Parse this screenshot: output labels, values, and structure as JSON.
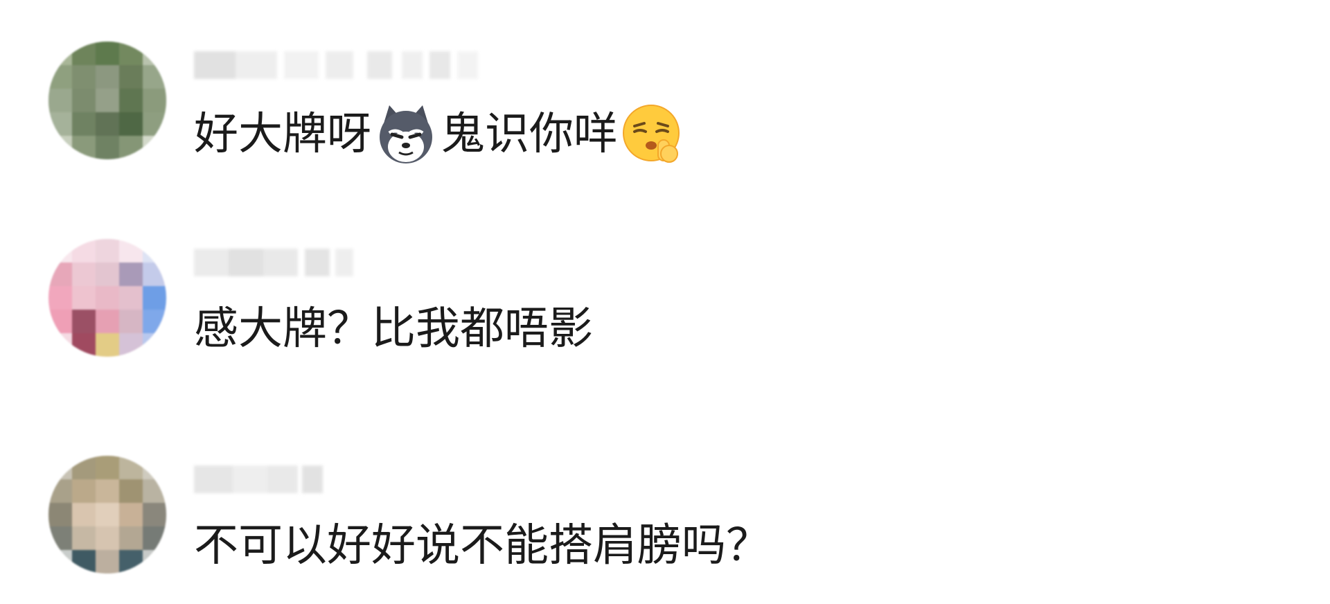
{
  "comments": [
    {
      "author_avatar": "pixelated-avatar-green",
      "text_parts": [
        "好大牌呀",
        "鬼识你咩"
      ],
      "emojis": [
        "husky-dog-emoji",
        "shush-face-emoji"
      ]
    },
    {
      "author_avatar": "pixelated-avatar-pink",
      "text": "感大牌？比我都唔影"
    },
    {
      "author_avatar": "pixelated-avatar-portrait",
      "text": "不可以好好说不能搭肩膀吗？"
    }
  ],
  "colors": {
    "text": "#1b1b1b",
    "background": "#ffffff",
    "name_placeholder": "#e6e6e6"
  }
}
